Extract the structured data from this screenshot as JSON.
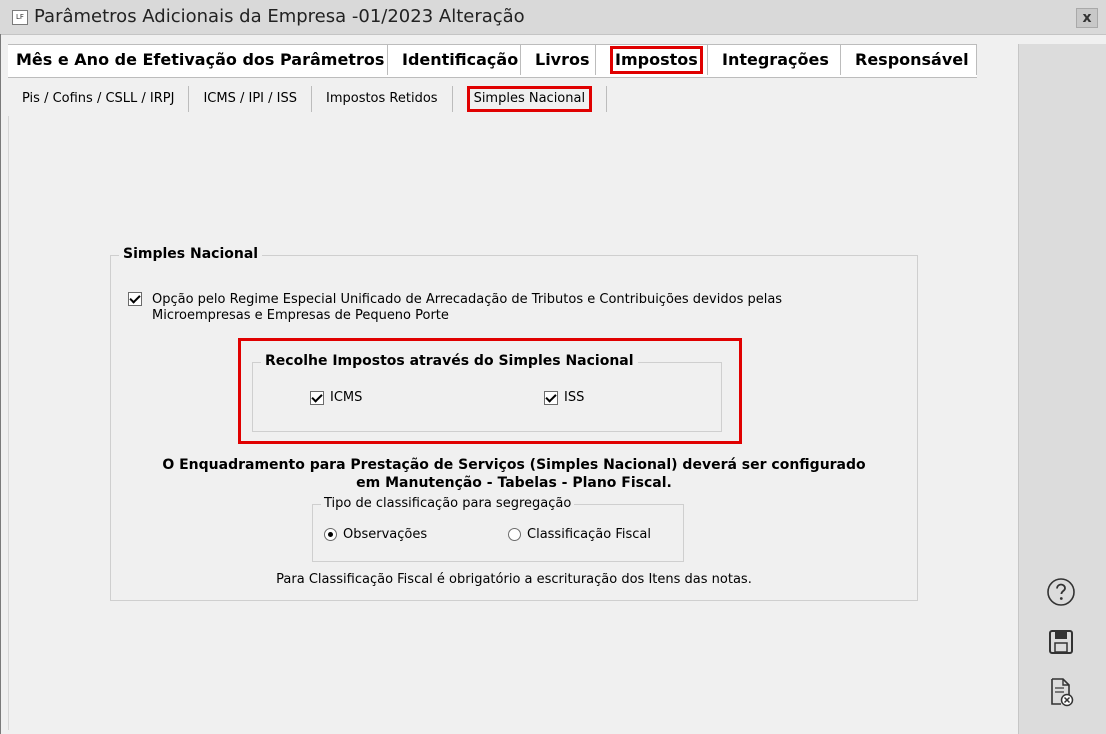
{
  "window": {
    "title": "Parâmetros Adicionais da Empresa -01/2023 Alteração",
    "icon_text": "LF",
    "close_label": "x"
  },
  "main_tabs": [
    {
      "label": "Mês e Ano de Efetivação dos Parâmetros",
      "active": false
    },
    {
      "label": "Identificação",
      "active": false
    },
    {
      "label": "Livros",
      "active": false
    },
    {
      "label": "Impostos",
      "active": true
    },
    {
      "label": "Integrações",
      "active": false
    },
    {
      "label": "Responsável",
      "active": false
    }
  ],
  "sub_tabs": [
    {
      "label": "Pis / Cofins / CSLL / IRPJ",
      "active": false
    },
    {
      "label": "ICMS / IPI / ISS",
      "active": false
    },
    {
      "label": "Impostos Retidos",
      "active": false
    },
    {
      "label": "Simples Nacional",
      "active": true
    }
  ],
  "simples": {
    "group_title": "Simples Nacional",
    "option_line1": "Opção pelo Regime Especial Unificado de Arrecadação de Tributos e Contribuições devidos pelas",
    "option_line2": "Microempresas e Empresas de Pequeno Porte",
    "option_checked": true,
    "recolhe_title": "Recolhe Impostos através do Simples Nacional",
    "icms_label": "ICMS",
    "icms_checked": true,
    "iss_label": "ISS",
    "iss_checked": true,
    "notice_line1": "O Enquadramento para Prestação de Serviços (Simples Nacional) deverá ser configurado",
    "notice_line2": "em Manutenção - Tabelas - Plano Fiscal.",
    "tipo_title": "Tipo de classificação para segregação",
    "radio_observacoes": "Observações",
    "radio_classificacao": "Classificação Fiscal",
    "selected_radio": "Observações",
    "footnote": "Para Classificação Fiscal é obrigatório a escrituração dos Itens das notas."
  },
  "side_icons": [
    "help-icon",
    "save-icon",
    "cancel-document-icon"
  ],
  "colors": {
    "highlight": "#e00000",
    "background": "#f0f0f0",
    "side_panel": "#dcdcdc"
  }
}
